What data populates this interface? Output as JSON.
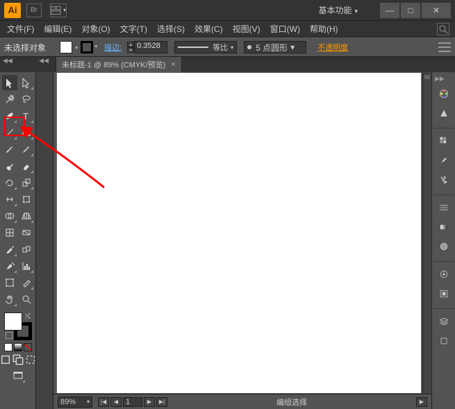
{
  "titlebar": {
    "logo": "Ai",
    "bridge": "Br",
    "workspace": "基本功能",
    "min": "—",
    "max": "□",
    "close": "✕"
  },
  "menu": {
    "file": "文件(F)",
    "edit": "编辑(E)",
    "object": "对象(O)",
    "type": "文字(T)",
    "select": "选择(S)",
    "effect": "效果(C)",
    "view": "视图(V)",
    "window": "窗口(W)",
    "help": "帮助(H)"
  },
  "control": {
    "noselection": "未选择对象",
    "stroke_label": "描边:",
    "stroke_weight": "0.3528",
    "scale_label": "等比",
    "profile_label": "5 点圆形",
    "opacity_label": "不透明度"
  },
  "doc_tab": {
    "label": "未标题-1 @ 89% (CMYK/预览)",
    "close": "×"
  },
  "status": {
    "zoom": "89%",
    "artboard": "1",
    "selection": "编组选择"
  }
}
